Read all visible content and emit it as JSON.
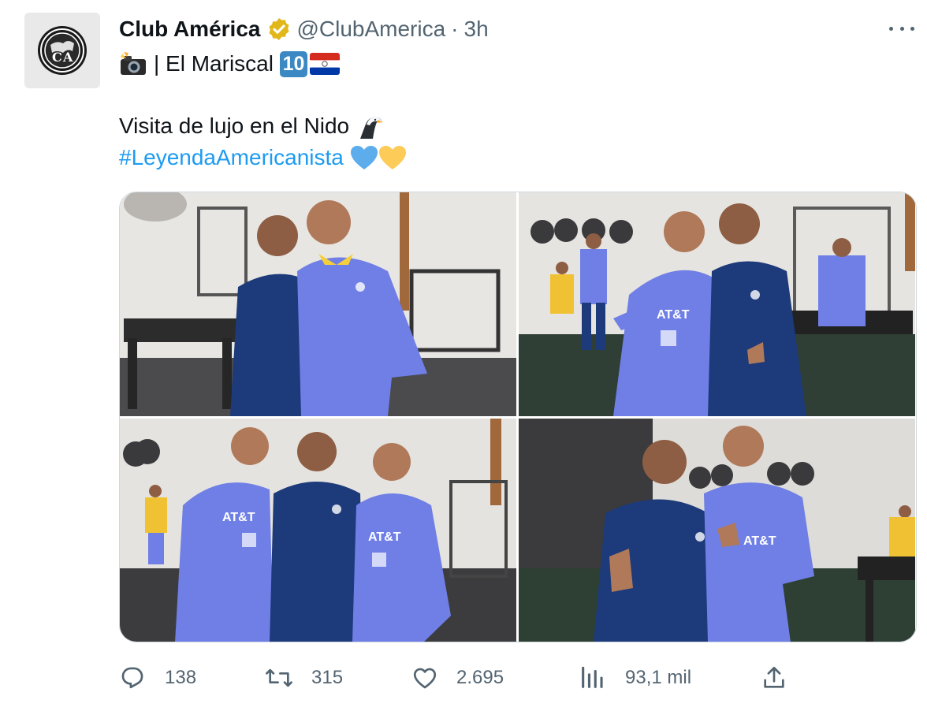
{
  "author": {
    "display_name": "Club América",
    "handle": "@ClubAmerica",
    "separator": "·",
    "time": "3h",
    "avatar_icon": "club-america-crest-icon",
    "verified_icon": "verified-badge-icon",
    "verified_color": "#e2b719"
  },
  "subtitle": {
    "camera_icon": "camera-flash-emoji",
    "text": "| El Mariscal",
    "keycap": "10",
    "flag_icon": "paraguay-flag-emoji"
  },
  "tweet": {
    "line1": "Visita de lujo en el Nido",
    "eagle_icon": "eagle-emoji",
    "hashtag": "#LeyendaAmericanista",
    "hearts": [
      "blue-heart-emoji",
      "yellow-heart-emoji"
    ]
  },
  "media": {
    "photos": [
      {
        "alt_icon": "photo-players-gym-1"
      },
      {
        "alt_icon": "photo-players-gym-2"
      },
      {
        "alt_icon": "photo-players-gym-3"
      },
      {
        "alt_icon": "photo-players-gym-4"
      }
    ]
  },
  "actions": {
    "reply_count": "138",
    "retweet_count": "315",
    "like_count": "2.695",
    "views_count": "93,1 mil",
    "reply_icon": "reply-icon",
    "retweet_icon": "retweet-icon",
    "like_icon": "heart-icon",
    "views_icon": "views-chart-icon",
    "share_icon": "share-icon"
  },
  "colors": {
    "text": "#0f1419",
    "secondary": "#536471",
    "link": "#1d9bf0",
    "kit_blue": "#6f7fe6",
    "kit_navy": "#1d3a7a"
  }
}
